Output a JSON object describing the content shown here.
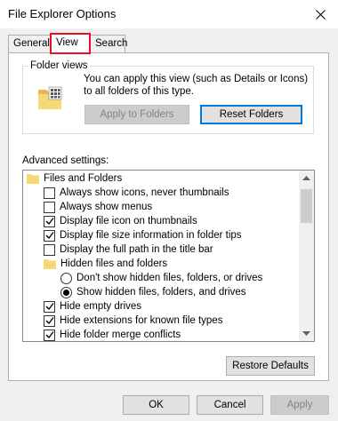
{
  "window": {
    "title": "File Explorer Options"
  },
  "tabs": [
    {
      "label": "General"
    },
    {
      "label": "View"
    },
    {
      "label": "Search"
    }
  ],
  "folder_views": {
    "legend": "Folder views",
    "description": "You can apply this view (such as Details or Icons) to all folders of this type.",
    "apply_button": "Apply to Folders",
    "reset_button": "Reset Folders"
  },
  "advanced": {
    "label": "Advanced settings:",
    "items": [
      {
        "type": "folder",
        "label": "Files and Folders"
      },
      {
        "type": "checkbox",
        "label": "Always show icons, never thumbnails",
        "checked": false
      },
      {
        "type": "checkbox",
        "label": "Always show menus",
        "checked": false
      },
      {
        "type": "checkbox",
        "label": "Display file icon on thumbnails",
        "checked": true
      },
      {
        "type": "checkbox",
        "label": "Display file size information in folder tips",
        "checked": true
      },
      {
        "type": "checkbox",
        "label": "Display the full path in the title bar",
        "checked": false
      },
      {
        "type": "folder",
        "label": "Hidden files and folders"
      },
      {
        "type": "radio",
        "label": "Don't show hidden files, folders, or drives",
        "checked": false
      },
      {
        "type": "radio",
        "label": "Show hidden files, folders, and drives",
        "checked": true
      },
      {
        "type": "checkbox",
        "label": "Hide empty drives",
        "checked": true
      },
      {
        "type": "checkbox",
        "label": "Hide extensions for known file types",
        "checked": true
      },
      {
        "type": "checkbox",
        "label": "Hide folder merge conflicts",
        "checked": true
      }
    ],
    "restore_button": "Restore Defaults"
  },
  "footer": {
    "ok": "OK",
    "cancel": "Cancel",
    "apply": "Apply"
  },
  "colors": {
    "focus_blue": "#0078d7",
    "highlight_red": "#e81123",
    "folder_yellow": "#f8d775"
  }
}
